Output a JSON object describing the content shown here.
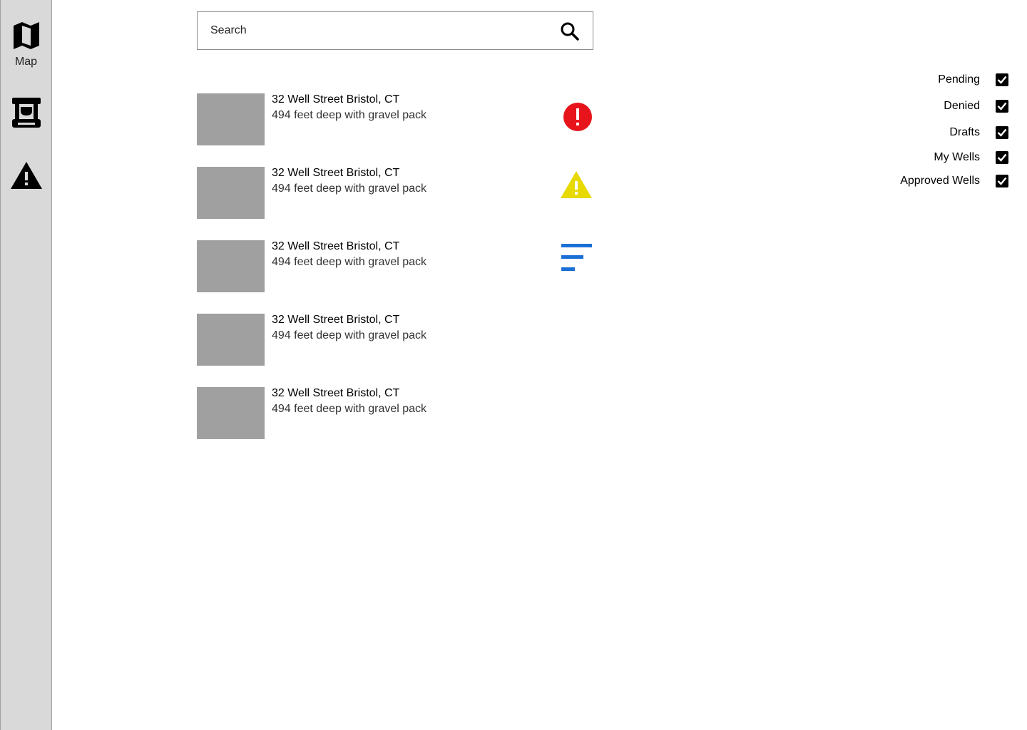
{
  "sidebar": {
    "items": [
      {
        "id": "map",
        "label": "Map",
        "icon": "map-icon"
      },
      {
        "id": "kiosk",
        "label": "",
        "icon": "kiosk-icon"
      },
      {
        "id": "alerts",
        "label": "",
        "icon": "warning-icon"
      }
    ]
  },
  "search": {
    "placeholder": "Search",
    "value": "",
    "icon": "search-icon"
  },
  "wells": [
    {
      "title": "32 Well Street Bristol, CT",
      "subtitle": "494 feet deep with gravel pack",
      "status": "error",
      "status_icon": "error-circle-icon"
    },
    {
      "title": "32 Well Street Bristol, CT",
      "subtitle": "494 feet deep with gravel pack",
      "status": "warning",
      "status_icon": "warning-triangle-icon"
    },
    {
      "title": "32 Well Street Bristol, CT",
      "subtitle": "494 feet deep with gravel pack",
      "status": "draft",
      "status_icon": "draft-lines-icon"
    },
    {
      "title": "32 Well Street Bristol, CT",
      "subtitle": "494 feet deep with gravel pack",
      "status": "",
      "status_icon": ""
    },
    {
      "title": "32 Well Street Bristol, CT",
      "subtitle": "494 feet deep with gravel pack",
      "status": "",
      "status_icon": ""
    }
  ],
  "filters": [
    {
      "label": "Pending",
      "checked": true
    },
    {
      "label": "Denied",
      "checked": true
    },
    {
      "label": "Drafts",
      "checked": true
    },
    {
      "label": "My Wells",
      "checked": true
    },
    {
      "label": "Approved Wells",
      "checked": true
    }
  ],
  "colors": {
    "sidebar_bg": "#d9d9d9",
    "thumbnail": "#a0a0a0",
    "error": "#e8141b",
    "warning": "#e8d900",
    "draft": "#1a6fd6",
    "checkbox": "#000000"
  }
}
